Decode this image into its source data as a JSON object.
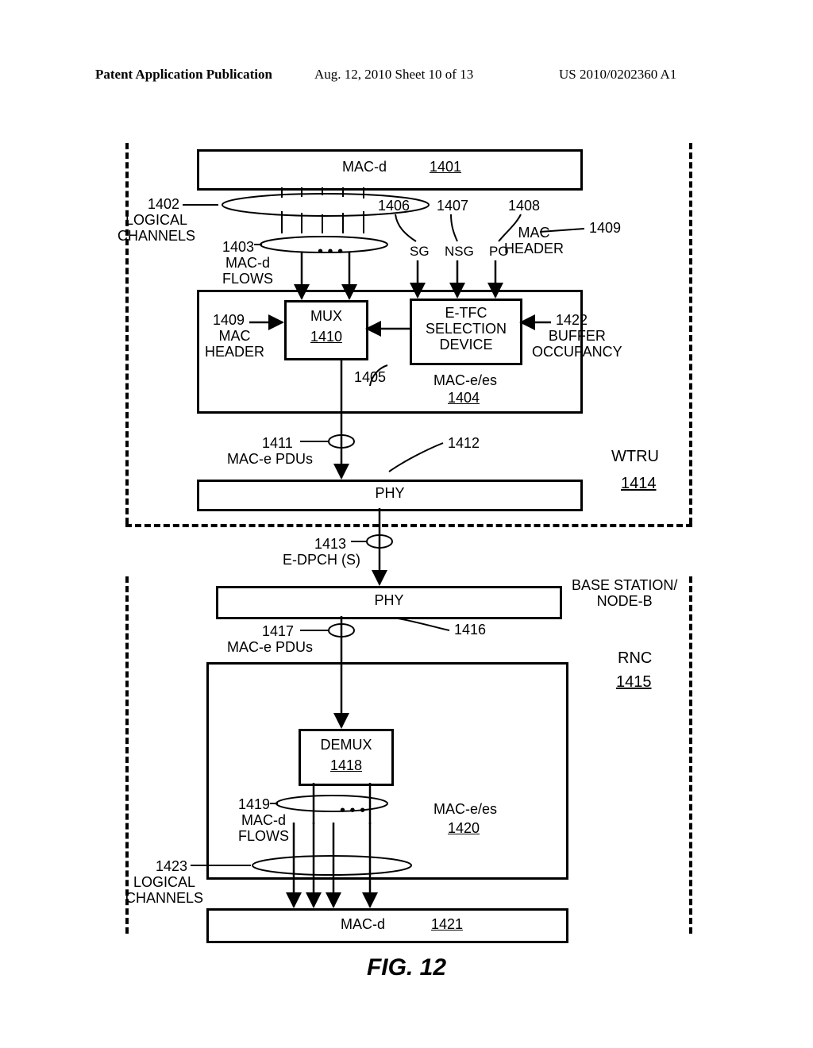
{
  "header": {
    "left": "Patent Application Publication",
    "center": "Aug. 12, 2010  Sheet 10 of 13",
    "right": "US 2010/0202360 A1"
  },
  "figure_caption": "FIG. 12",
  "labels": {
    "logical_channels_top": "LOGICAL\nCHANNELS",
    "n1402": "1402",
    "macd_top": "MAC-d",
    "n1401": "1401",
    "n1406": "1406",
    "n1407": "1407",
    "n1408": "1408",
    "sg": "SG",
    "nsg": "NSG",
    "po": "PO",
    "mac_header_right": "MAC\nHEADER",
    "n1409_right": "1409",
    "n1403": "1403",
    "macd_flows_top": "MAC-d\nFLOWS",
    "mux": "MUX",
    "n1410": "1410",
    "etfc_sel": "E-TFC\nSELECTION\nDEVICE",
    "n1422": "1422",
    "buffer_occ": "BUFFER\nOCCUPANCY",
    "n1409_left": "1409",
    "mac_header_left": "MAC\nHEADER",
    "n1405": "1405",
    "mac_e_es_top": "MAC-e/es",
    "n1404": "1404",
    "n1411": "1411",
    "mace_pdus_top": "MAC-e PDUs",
    "n1412": "1412",
    "phy_top": "PHY",
    "wtru": "WTRU",
    "n1414": "1414",
    "n1413": "1413",
    "edpch": "E-DPCH (S)",
    "phy_bot": "PHY",
    "base_node": "BASE STATION/\nNODE-B",
    "n1416": "1416",
    "n1417": "1417",
    "mace_pdus_bot": "MAC-e PDUs",
    "rnc": "RNC",
    "n1415": "1415",
    "demux": "DEMUX",
    "n1418": "1418",
    "n1419": "1419",
    "macd_flows_bot": "MAC-d\nFLOWS",
    "mac_e_es_bot": "MAC-e/es",
    "n1420": "1420",
    "n1423": "1423",
    "logical_channels_bot": "LOGICAL\nCHANNELS",
    "macd_bot": "MAC-d",
    "n1421": "1421",
    "dots": "•  •  •"
  }
}
